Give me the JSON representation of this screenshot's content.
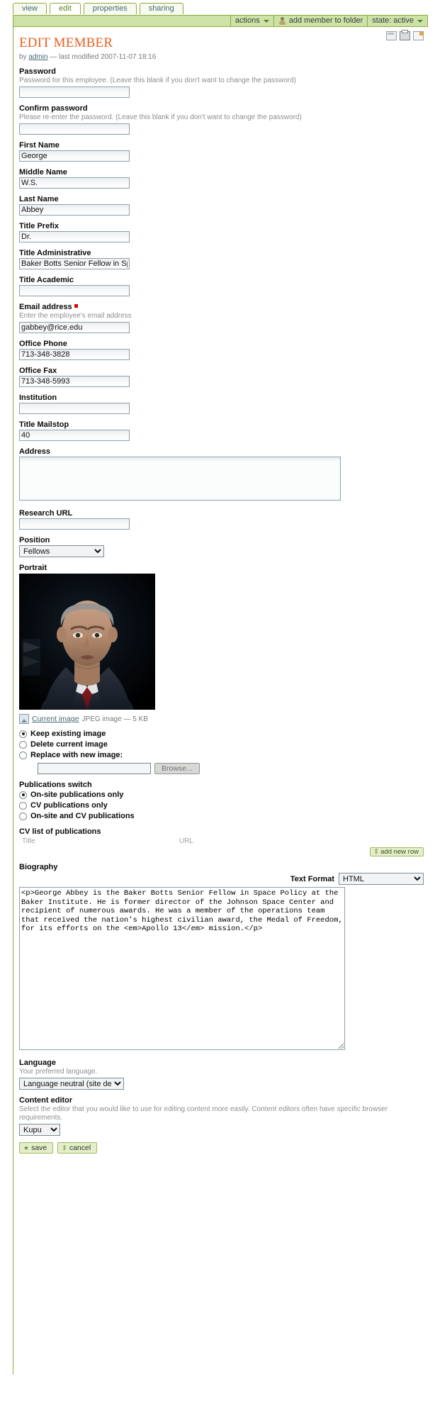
{
  "tabs": [
    {
      "label": "view",
      "selected": false
    },
    {
      "label": "edit",
      "selected": true
    },
    {
      "label": "properties",
      "selected": false
    },
    {
      "label": "sharing",
      "selected": false
    }
  ],
  "actionbar": {
    "actions_label": "actions",
    "add_member_label": "add member to folder",
    "state_label": "state: active"
  },
  "doc": {
    "title": "EDIT MEMBER",
    "byline_prefix": "by",
    "byline_author": "admin",
    "byline_suffix": "— last modified 2007-11-07 18:16"
  },
  "fields": {
    "password": {
      "label": "Password",
      "help": "Password for this employee. (Leave this blank if you don't want to change the password)",
      "value": ""
    },
    "confirm_password": {
      "label": "Confirm password",
      "help": "Please re-enter the password. (Leave this blank if you don't want to change the password)",
      "value": ""
    },
    "first_name": {
      "label": "First Name",
      "value": "George"
    },
    "middle_name": {
      "label": "Middle Name",
      "value": "W.S."
    },
    "last_name": {
      "label": "Last Name",
      "value": "Abbey"
    },
    "title_prefix": {
      "label": "Title Prefix",
      "value": "Dr."
    },
    "title_administrative": {
      "label": "Title Administrative",
      "value": "Baker Botts Senior Fellow in Space Policy"
    },
    "title_academic": {
      "label": "Title Academic",
      "value": ""
    },
    "email": {
      "label": "Email address",
      "help": "Enter the employee's email address",
      "value": "gabbey@rice.edu",
      "required": true
    },
    "office_phone": {
      "label": "Office Phone",
      "value": "713-348-3828"
    },
    "office_fax": {
      "label": "Office Fax",
      "value": "713-348-5993"
    },
    "institution": {
      "label": "Institution",
      "value": ""
    },
    "title_mailstop": {
      "label": "Title Mailstop",
      "value": "40"
    },
    "address": {
      "label": "Address",
      "value": ""
    },
    "research_url": {
      "label": "Research URL",
      "value": ""
    },
    "position": {
      "label": "Position",
      "value": "Fellows",
      "options": [
        "Fellows"
      ]
    },
    "portrait": {
      "label": "Portrait",
      "current_image_link": "Current image",
      "current_image_meta": "JPEG image — 5 KB",
      "options": [
        {
          "label": "Keep existing image",
          "selected": true
        },
        {
          "label": "Delete current image",
          "selected": false
        },
        {
          "label": "Replace with new image:",
          "selected": false
        }
      ],
      "file_value": "",
      "browse_label": "Browse..."
    },
    "publications_switch": {
      "label": "Publications switch",
      "options": [
        {
          "label": "On-site publications only",
          "selected": true
        },
        {
          "label": "CV publications only",
          "selected": false
        },
        {
          "label": "On-site and CV publications",
          "selected": false
        }
      ]
    },
    "cv_publications": {
      "label": "CV list of publications",
      "columns": [
        "Title",
        "URL"
      ],
      "add_row_label": "add new row",
      "rows": []
    },
    "biography": {
      "label": "Biography",
      "text_format_label": "Text Format",
      "text_format_value": "HTML",
      "text_format_options": [
        "HTML"
      ],
      "value": "<p>George Abbey is the Baker Botts Senior Fellow in Space Policy at the Baker Institute. He is former director of the Johnson Space Center and recipient of numerous awards. He was a member of the operations team that received the nation’s highest civilian award, the Medal of Freedom, for its efforts on the <em>Apollo 13</em> mission.</p>"
    },
    "language": {
      "label": "Language",
      "help": "Your preferred language.",
      "value": "Language neutral (site default)",
      "options": [
        "Language neutral (site default)"
      ]
    },
    "content_editor": {
      "label": "Content editor",
      "help": "Select the editor that you would like to use for editing content more easily. Content editors often have specific browser requirements.",
      "value": "Kupu",
      "options": [
        "Kupu"
      ]
    }
  },
  "footer": {
    "save_label": "save",
    "cancel_label": "cancel"
  },
  "colors": {
    "accent_green": "#8cac3e",
    "bar_green": "#cde2a7",
    "title_orange": "#e8601c",
    "required_red": "#d00000",
    "link_blue": "#436976"
  }
}
